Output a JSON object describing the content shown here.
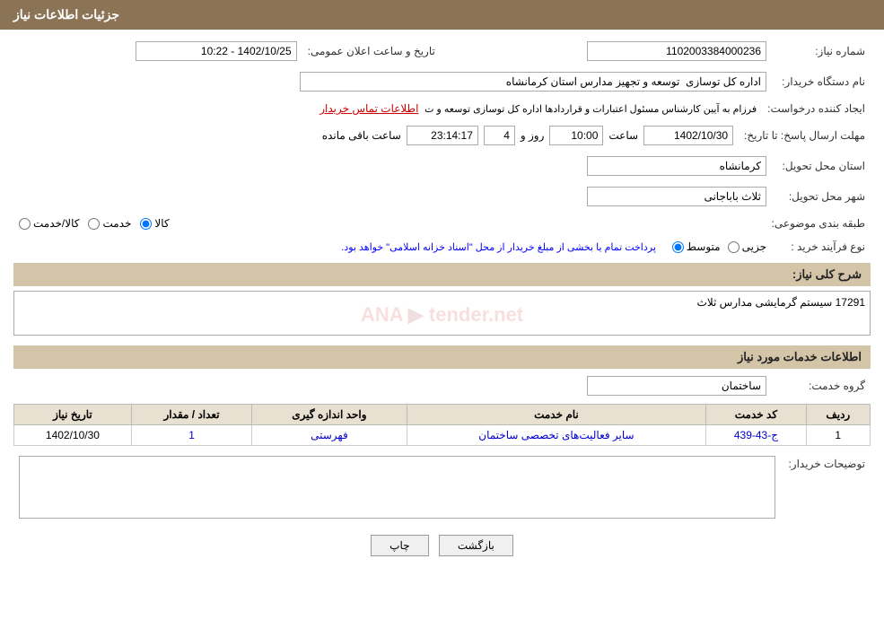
{
  "header": {
    "title": "جزئیات اطلاعات نیاز"
  },
  "fields": {
    "shomareNiaz_label": "شماره نیاز:",
    "shomareNiaz_value": "1102003384000236",
    "tarikhElan_label": "تاریخ و ساعت اعلان عمومی:",
    "tarikhElan_value": "1402/10/25 - 10:22",
    "namDastgah_label": "نام دستگاه خریدار:",
    "namDastgah_value": "اداره کل توسازی  توسعه و تجهیز مدارس استان کرمانشاه",
    "ijadKonnande_label": "ایجاد کننده درخواست:",
    "ijadKonnande_value": "فرزام به آیین کارشناس مسئول اعتبارات و قراردادها اداره کل توسازی  توسعه و ت",
    "ijadKonnande_link": "اطلاعات تماس خریدار",
    "mohlat_label": "مهلت ارسال پاسخ: تا تاریخ:",
    "mohlat_date": "1402/10/30",
    "mohlat_saat_label": "ساعت",
    "mohlat_saat": "10:00",
    "mohlat_rooz_label": "روز و",
    "mohlat_rooz": "4",
    "mohlat_remaining": "23:14:17",
    "mohlat_remaining_label": "ساعت باقی مانده",
    "ostanTahvil_label": "استان محل تحویل:",
    "ostanTahvil_value": "کرمانشاه",
    "shahrTahvil_label": "شهر محل تحویل:",
    "shahrTahvil_value": "ثلاث باباجانی",
    "tabagheBandi_label": "طبقه بندی موضوعی:",
    "radio_kala": "کالا",
    "radio_khedmat": "خدمت",
    "radio_kala_khedmat": "کالا/خدمت",
    "noeFarayand_label": "نوع فرآیند خرید :",
    "radio_jozi": "جزیی",
    "radio_motovaset": "متوسط",
    "farayand_desc": "پرداخت تمام یا بخشی از مبلغ خریدار از محل \"اسناد خزانه اسلامی\" خواهد بود.",
    "sharhKoli_label": "شرح کلی نیاز:",
    "sharhKoli_value": "17291 سیستم گرمایشی مدارس ثلاث",
    "khadamat_section": "اطلاعات خدمات مورد نیاز",
    "geroheKhedmat_label": "گروه خدمت:",
    "geroheKhedmat_value": "ساختمان",
    "table_headers": [
      "ردیف",
      "کد خدمت",
      "نام خدمت",
      "واحد اندازه گیری",
      "تعداد / مقدار",
      "تاریخ نیاز"
    ],
    "table_rows": [
      {
        "radif": "1",
        "kodKhedmat": "ج-43-439",
        "namKhedmat": "سایر فعالیت‌های تخصصی ساختمان",
        "vahed": "فهرستی",
        "tedad": "1",
        "tarikh": "1402/10/30"
      }
    ],
    "towzihKharidar_label": "توضیحات خریدار:",
    "towzihKharidar_value": "",
    "btn_back": "بازگشت",
    "btn_print": "چاپ"
  }
}
